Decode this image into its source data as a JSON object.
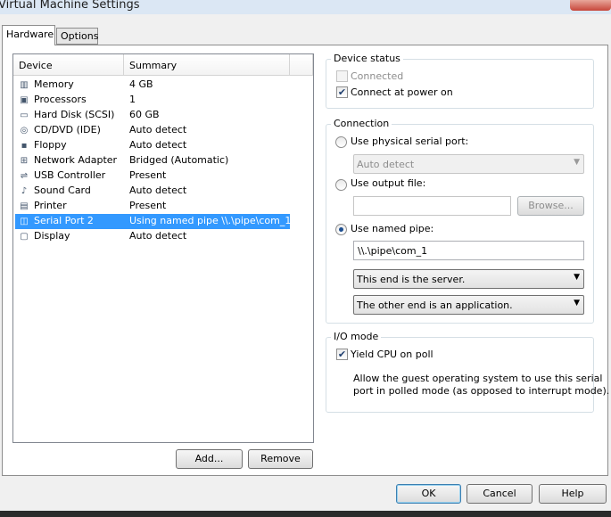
{
  "window": {
    "title": "Virtual Machine Settings"
  },
  "tabs": [
    {
      "label": "Hardware",
      "active": true
    },
    {
      "label": "Options",
      "active": false
    }
  ],
  "device_list": {
    "columns": [
      "Device",
      "Summary"
    ],
    "rows": [
      {
        "icon": "memory-icon",
        "device": "Memory",
        "summary": "4 GB"
      },
      {
        "icon": "processor-icon",
        "device": "Processors",
        "summary": "1"
      },
      {
        "icon": "hard-disk-icon",
        "device": "Hard Disk (SCSI)",
        "summary": "60 GB"
      },
      {
        "icon": "cd-dvd-icon",
        "device": "CD/DVD (IDE)",
        "summary": "Auto detect"
      },
      {
        "icon": "floppy-icon",
        "device": "Floppy",
        "summary": "Auto detect"
      },
      {
        "icon": "network-adapter-icon",
        "device": "Network Adapter",
        "summary": "Bridged (Automatic)"
      },
      {
        "icon": "usb-icon",
        "device": "USB Controller",
        "summary": "Present"
      },
      {
        "icon": "sound-card-icon",
        "device": "Sound Card",
        "summary": "Auto detect"
      },
      {
        "icon": "printer-icon",
        "device": "Printer",
        "summary": "Present"
      },
      {
        "icon": "serial-port-icon",
        "device": "Serial Port 2",
        "summary": "Using named pipe \\\\.\\pipe\\com_1",
        "selected": true
      },
      {
        "icon": "display-icon",
        "device": "Display",
        "summary": "Auto detect"
      }
    ]
  },
  "buttons": {
    "add": "Add...",
    "remove": "Remove",
    "ok": "OK",
    "cancel": "Cancel",
    "help": "Help"
  },
  "device_status": {
    "title": "Device status",
    "connected": {
      "label": "Connected",
      "checked": false,
      "enabled": false
    },
    "connect_at_power_on": {
      "label": "Connect at power on",
      "checked": true
    }
  },
  "connection": {
    "title": "Connection",
    "physical_serial_port": {
      "label": "Use physical serial port:",
      "selected": false
    },
    "physical_port_value": "Auto detect",
    "output_file": {
      "label": "Use output file:",
      "selected": false
    },
    "output_file_value": "",
    "browse": "Browse...",
    "named_pipe": {
      "label": "Use named pipe:",
      "selected": true
    },
    "named_pipe_value": "\\\\.\\pipe\\com_1",
    "this_end": "This end is the server.",
    "other_end": "The other end is an application."
  },
  "io_mode": {
    "title": "I/O mode",
    "yield_cpu": {
      "label": "Yield CPU on poll",
      "checked": true
    },
    "description_line1": "Allow the guest operating system to use this serial",
    "description_line2": "port in polled mode (as opposed to interrupt mode)."
  },
  "glyphs": {
    "check": "✔",
    "dropdown_arrow": "▼"
  },
  "colors": {
    "selection": "#3399ff",
    "panel_border": "#8d8d8d"
  }
}
